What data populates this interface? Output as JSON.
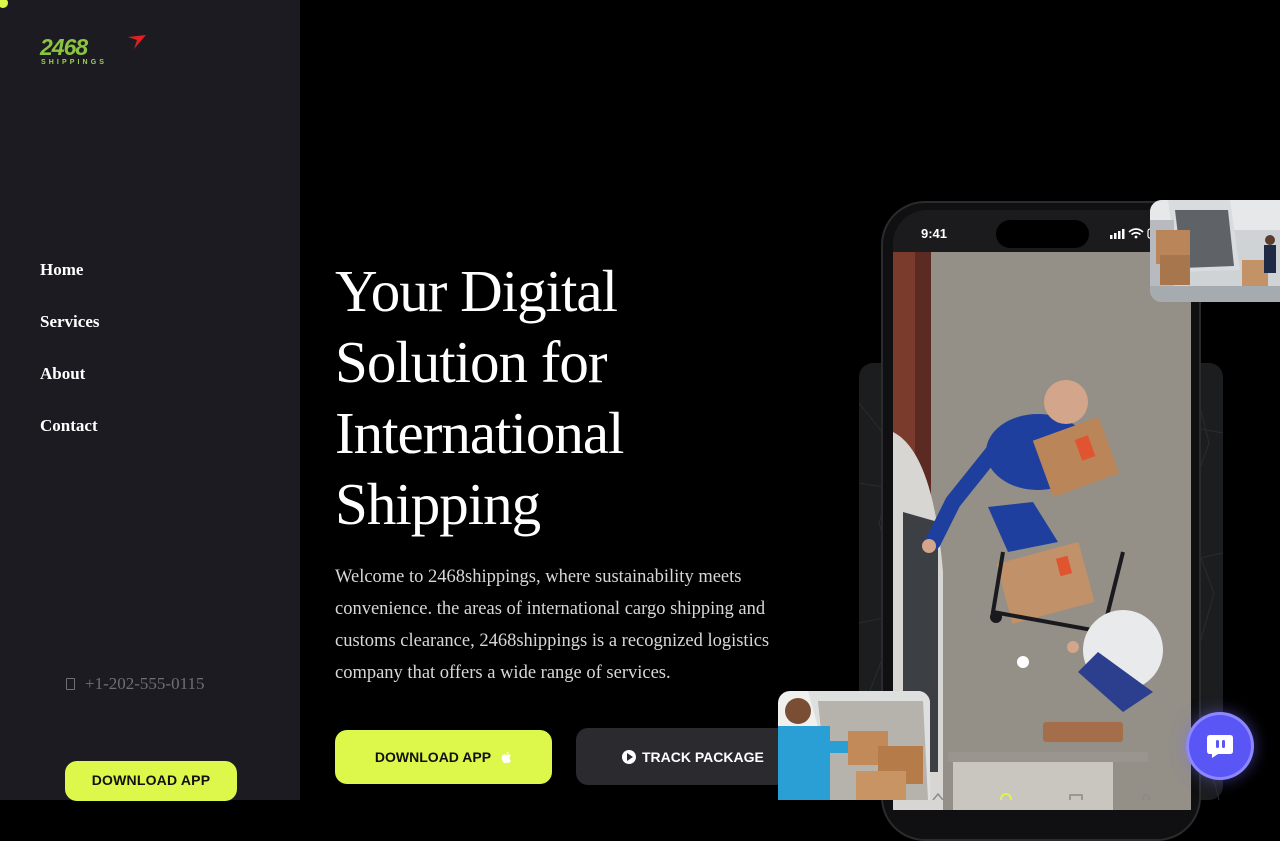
{
  "brand": {
    "logo_number": "2468",
    "logo_sub": "SHIPPINGS",
    "logo_color": "#8bc53f",
    "accent_color": "#ddf84a",
    "arrow_color": "#e02020"
  },
  "sidebar": {
    "nav": [
      {
        "label": "Home"
      },
      {
        "label": "Services"
      },
      {
        "label": "About"
      },
      {
        "label": "Contact"
      }
    ],
    "phone": "+1-202-555-0115",
    "phone_icon": "phone-icon",
    "download_label": "DOWNLOAD APP"
  },
  "hero": {
    "title_lines": [
      "Your Digital",
      "Solution for",
      "International",
      "Shipping"
    ],
    "intro": "Welcome to 2468shippings, where sustainability meets convenience. the areas of international cargo shipping and customs clearance, 2468shippings is a recognized logistics company that offers a wide range of services.",
    "download_label": "DOWNLOAD APP",
    "download_icon": "apple-icon",
    "track_label": "TRACK PACKAGE",
    "track_icon": "play-icon"
  },
  "phone_mockup": {
    "time": "9:41",
    "status_icons": [
      "signal-icon",
      "wifi-icon",
      "battery-icon"
    ]
  },
  "chat": {
    "icon": "chat-icon",
    "color": "#5a55f5"
  }
}
